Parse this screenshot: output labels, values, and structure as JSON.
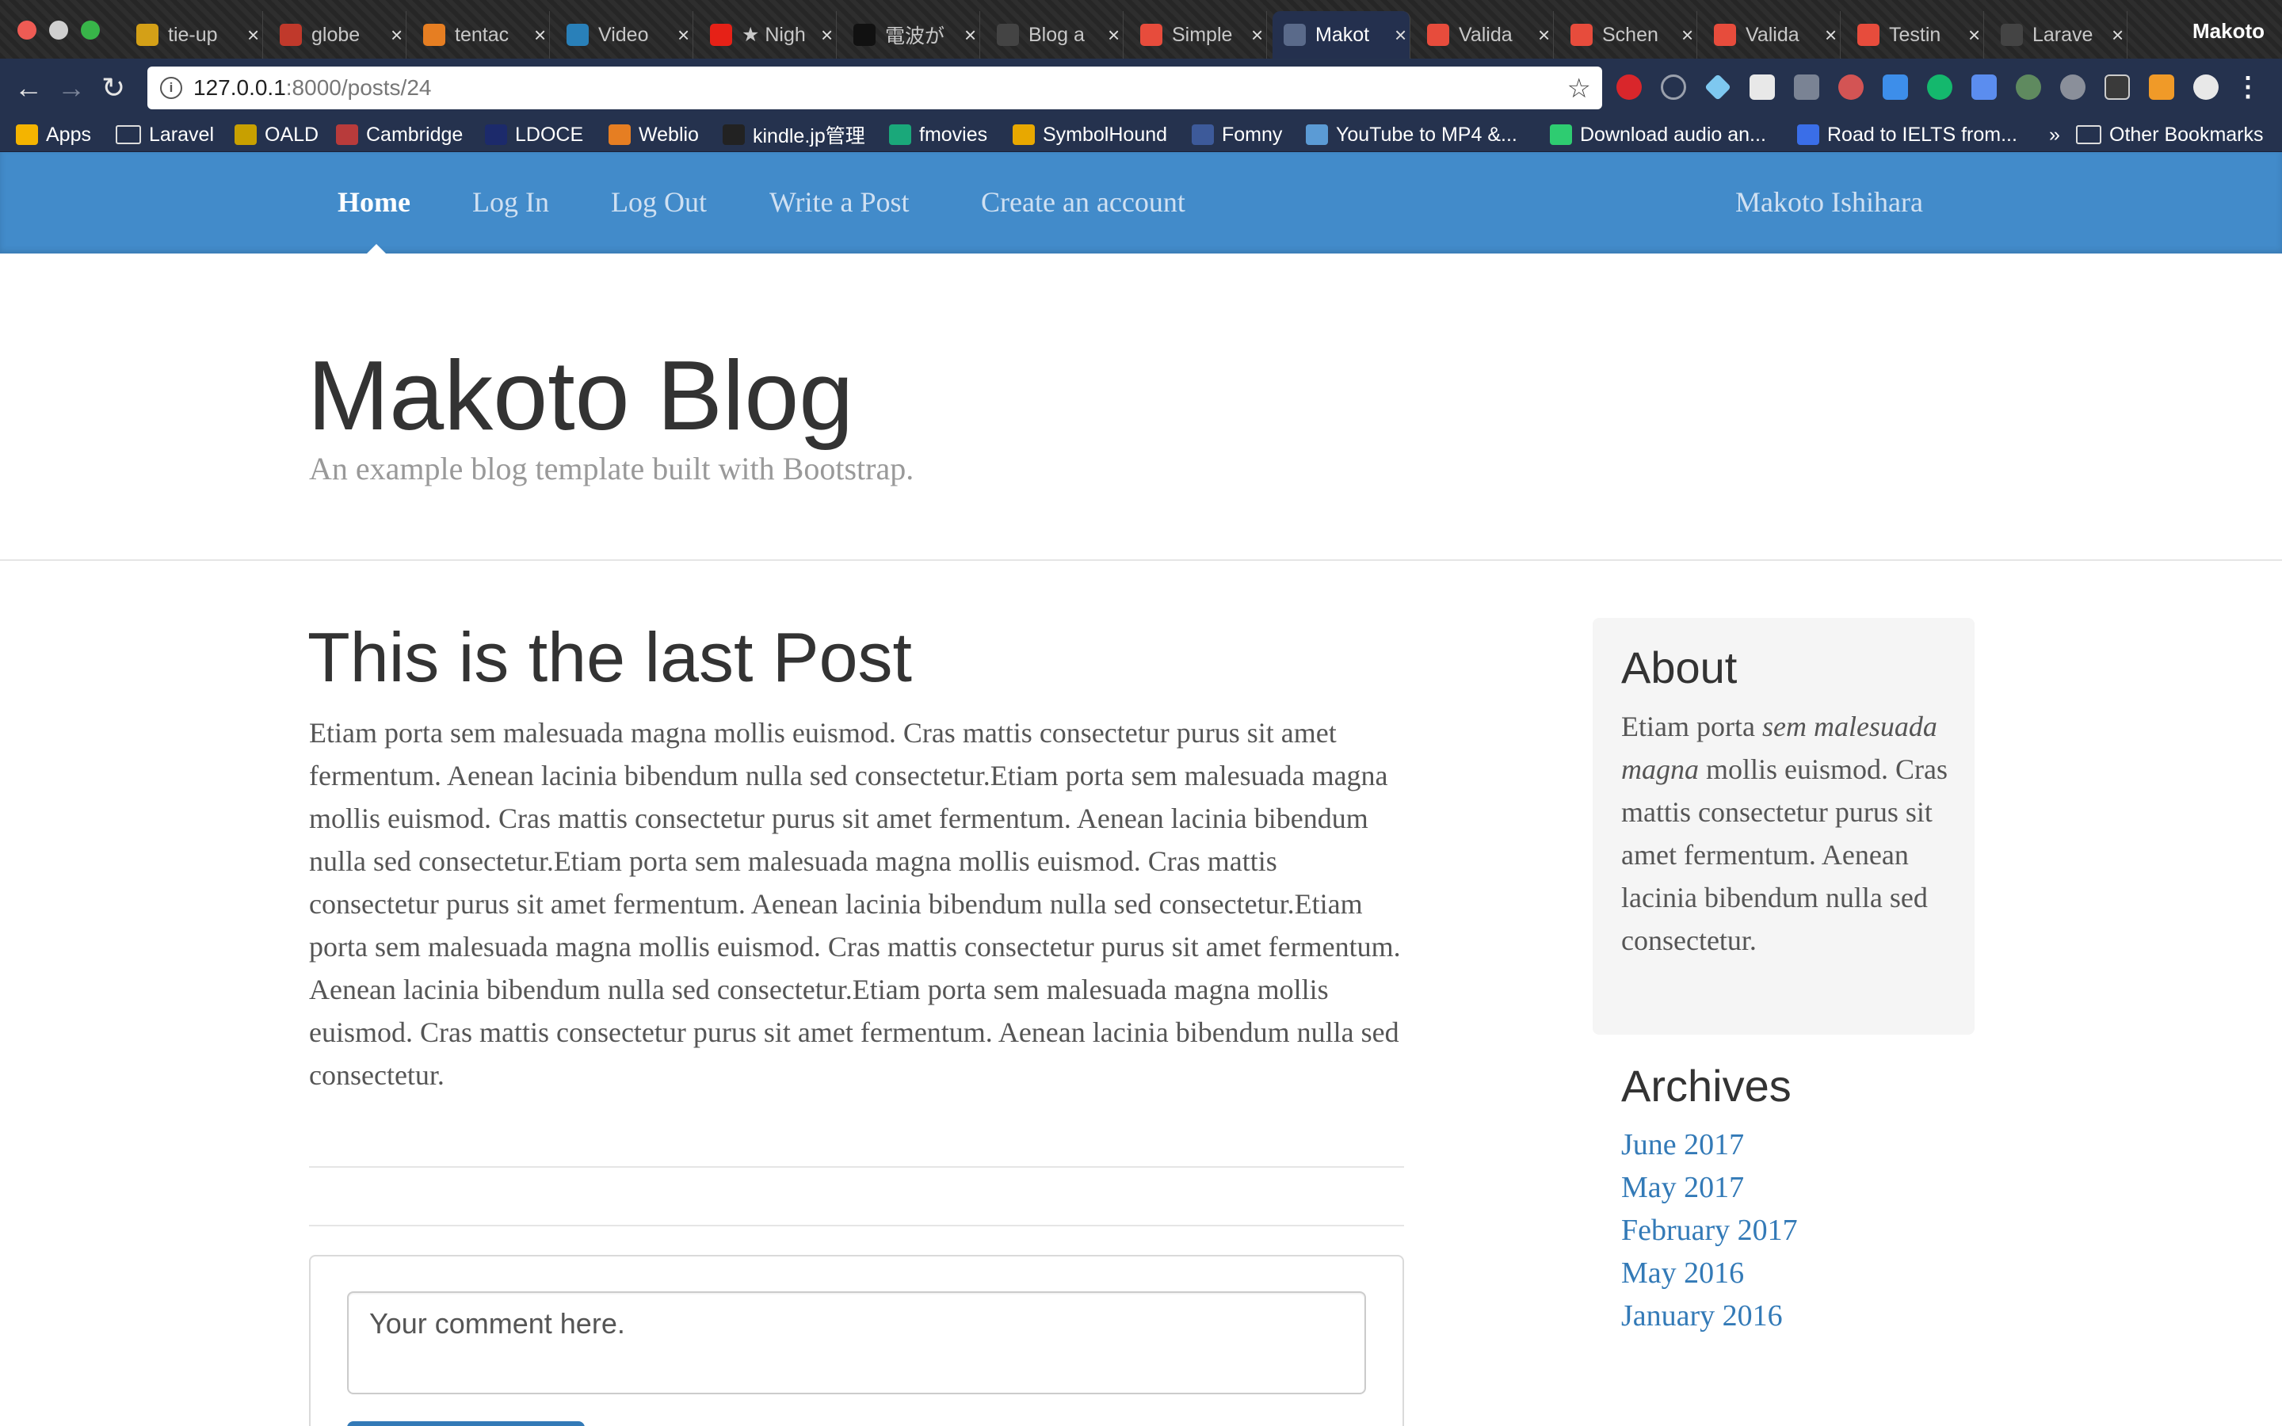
{
  "browser": {
    "profile_name": "Makoto",
    "tabs": [
      {
        "label": "tie-up",
        "color": "#d4a017",
        "active": false
      },
      {
        "label": "globe",
        "color": "#c0392b",
        "active": false
      },
      {
        "label": "tentac",
        "color": "#e67e22",
        "active": false
      },
      {
        "label": "Video",
        "color": "#2980b9",
        "active": false
      },
      {
        "label": "★ Nigh",
        "color": "#e62117",
        "active": false
      },
      {
        "label": "電波が",
        "color": "#111111",
        "active": false
      },
      {
        "label": "Blog a",
        "color": "#444444",
        "active": false
      },
      {
        "label": "Simple",
        "color": "#e74c3c",
        "active": false
      },
      {
        "label": "Makot",
        "color": "#5a6a8a",
        "active": true
      },
      {
        "label": "Valida",
        "color": "#e74c3c",
        "active": false
      },
      {
        "label": "Schen",
        "color": "#e74c3c",
        "active": false
      },
      {
        "label": "Valida",
        "color": "#e74c3c",
        "active": false
      },
      {
        "label": "Testin",
        "color": "#e74c3c",
        "active": false
      },
      {
        "label": "Larave",
        "color": "#444444",
        "active": false
      }
    ],
    "url_host": "127.0.0.1",
    "url_rest": ":8000/posts/24",
    "bookmarks": [
      {
        "label": "Apps",
        "icon": "apps-grid-icon"
      },
      {
        "label": "Laravel",
        "icon": "folder-icon"
      },
      {
        "label": "OALD",
        "icon": "oald-icon"
      },
      {
        "label": "Cambridge",
        "icon": "cambridge-icon"
      },
      {
        "label": "LDOCE",
        "icon": "ldoce-icon"
      },
      {
        "label": "Weblio",
        "icon": "weblio-icon"
      },
      {
        "label": "kindle.jp管理",
        "icon": "amazon-icon"
      },
      {
        "label": "fmovies",
        "icon": "play-icon"
      },
      {
        "label": "SymbolHound",
        "icon": "symbolhound-icon"
      },
      {
        "label": "Fomny",
        "icon": "fomny-icon"
      },
      {
        "label": "YouTube to MP4 &...",
        "icon": "youtube-mp4-icon"
      },
      {
        "label": "Download audio an...",
        "icon": "rocket-icon"
      },
      {
        "label": "Road to IELTS from...",
        "icon": "ielts-icon"
      },
      {
        "label": "»",
        "icon": ""
      },
      {
        "label": "Other Bookmarks",
        "icon": "folder-icon"
      }
    ]
  },
  "site_nav": {
    "links": [
      "Home",
      "Log In",
      "Log Out",
      "Write a Post",
      "Create an account"
    ],
    "user": "Makoto Ishihara"
  },
  "header": {
    "title": "Makoto Blog",
    "description": "An example blog template built with Bootstrap."
  },
  "post": {
    "title": "This is the last Post",
    "body": "Etiam porta sem malesuada magna mollis euismod. Cras mattis consectetur purus sit amet fermentum. Aenean lacinia bibendum nulla sed consectetur.Etiam porta sem malesuada magna mollis euismod. Cras mattis consectetur purus sit amet fermentum. Aenean lacinia bibendum nulla sed consectetur.Etiam porta sem malesuada magna mollis euismod. Cras mattis consectetur purus sit amet fermentum. Aenean lacinia bibendum nulla sed consectetur.Etiam porta sem malesuada magna mollis euismod. Cras mattis consectetur purus sit amet fermentum. Aenean lacinia bibendum nulla sed consectetur.Etiam porta sem malesuada magna mollis euismod. Cras mattis consectetur purus sit amet fermentum. Aenean lacinia bibendum nulla sed consectetur."
  },
  "comment": {
    "placeholder": "Your comment here."
  },
  "sidebar": {
    "about_title": "About",
    "about_text_start": "Etiam porta ",
    "about_text_em": "sem malesuada magna",
    "about_text_end": " mollis euismod. Cras mattis consectetur purus sit amet fermentum. Aenean lacinia bibendum nulla sed consectetur.",
    "archives_title": "Archives",
    "archives": [
      "June 2017",
      "May 2017",
      "February 2017",
      "May 2016",
      "January 2016"
    ]
  },
  "colors": {
    "navbar": "#428bca",
    "link": "#337ab7",
    "browser_toolbar": "#25324e"
  }
}
